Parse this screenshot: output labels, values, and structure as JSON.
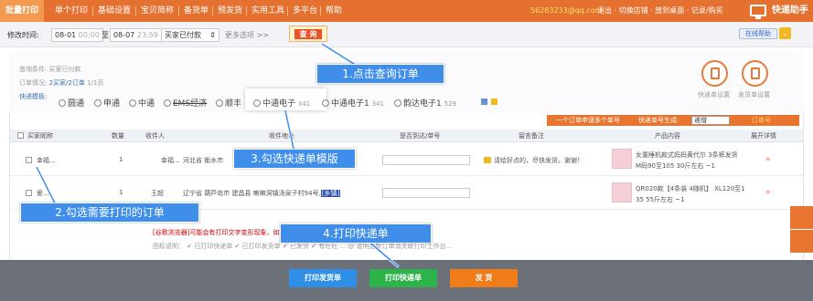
{
  "topnav": {
    "tabs": [
      "批量打印",
      "单个打印",
      "基础设置",
      "宝贝简称",
      "备货单",
      "预发货",
      "实用工具",
      "多平台",
      "帮助"
    ],
    "account_email": "56283233@qq.com",
    "account_links": "退出 · 切换店铺 · 放到桌面 · 记录/购买",
    "quick_assistant": "快递助手"
  },
  "filterbar": {
    "modify_time_label": "修改时间:",
    "date_from": "08-01",
    "time_from": "00:00",
    "to_label": "至",
    "date_to": "08-07",
    "time_to": "23:59",
    "status_value": "买家已付款",
    "more_options": "更多选项 >>",
    "query_button": "查 询",
    "online_help": "在线帮助"
  },
  "info": {
    "query_condition_label": "查询条件:",
    "query_condition_value": "买家已付款",
    "order_status_label": "订单情况:",
    "order_status_value": "2买家/2订单",
    "page_value": "1/1页",
    "express_template_label": "快递模板:"
  },
  "templates": [
    {
      "name": "圆通",
      "count": ""
    },
    {
      "name": "申通",
      "count": ""
    },
    {
      "name": "中通",
      "count": ""
    },
    {
      "name": "EMS经济",
      "count": ""
    },
    {
      "name": "顺丰",
      "count": ""
    },
    {
      "name": "中通电子",
      "count": "341"
    },
    {
      "name": "中通电子1",
      "count": "341"
    },
    {
      "name": "韵达电子1",
      "count": "529"
    }
  ],
  "icons_right": {
    "express_setting": "快递单设置",
    "shipping_setting": "发货单设置"
  },
  "order_bar": {
    "one_order_multi": "一个订单申请多个单号",
    "express_number_gen": "快递单号生成:",
    "gen_select": "递增",
    "order_number": "订单号"
  },
  "table": {
    "headers": [
      "买家昵称",
      "数量",
      "收件人",
      "收件地址",
      "是否到达/单号",
      "留言备注",
      "产品内容",
      "展开详情"
    ],
    "rows": [
      {
        "buyer": "幸福...",
        "qty": "1",
        "recipient": "幸福...",
        "address": "河北省 衡水市",
        "memo": "请给好点的，尽快发货。谢谢！",
        "product": "女童睡机款式妈妈黄代尔 3条裤发货",
        "product_line2": "M码90至105 30斤左右 ~1"
      },
      {
        "buyer": "爱...",
        "qty": "1",
        "recipient": "王超",
        "address": "辽宁省 葫芦岛市 建昌县 喇嘛洞镇汤泉子村94号,",
        "address_tag": "[乡镇]",
        "memo": "",
        "product": "QR020款【4条装 4随机】 XL120至1",
        "product_line2": "35 55斤左右 ~1"
      }
    ]
  },
  "tips": {
    "tip1_red": "[谷歌浏览器]",
    "tip1_rest": "可能会有打印文字变形现象，如需更好",
    "tip2": "图标说明：  ✔ 已打印快递单  ✔ 已打印发货单  ✔ 已发货  ✔ 有旺旺 ...  @ 说明是新订单请关联打印工作台..."
  },
  "bottom": {
    "print_shipping": "打印发货单",
    "print_express": "打印快递单",
    "ship": "发 货"
  },
  "callouts": {
    "c1": "1.点击查询订单",
    "c2": "2.勾选需要打印的订单",
    "c3": "3.勾选快递单模版",
    "c4": "4.打印快递单"
  },
  "colors": {
    "nav_orange": "#e4712f",
    "callout_blue": "#3e8eea",
    "print_blue": "#2f8fe6",
    "print_green": "#2cb34a",
    "ship_orange": "#f07d19"
  }
}
